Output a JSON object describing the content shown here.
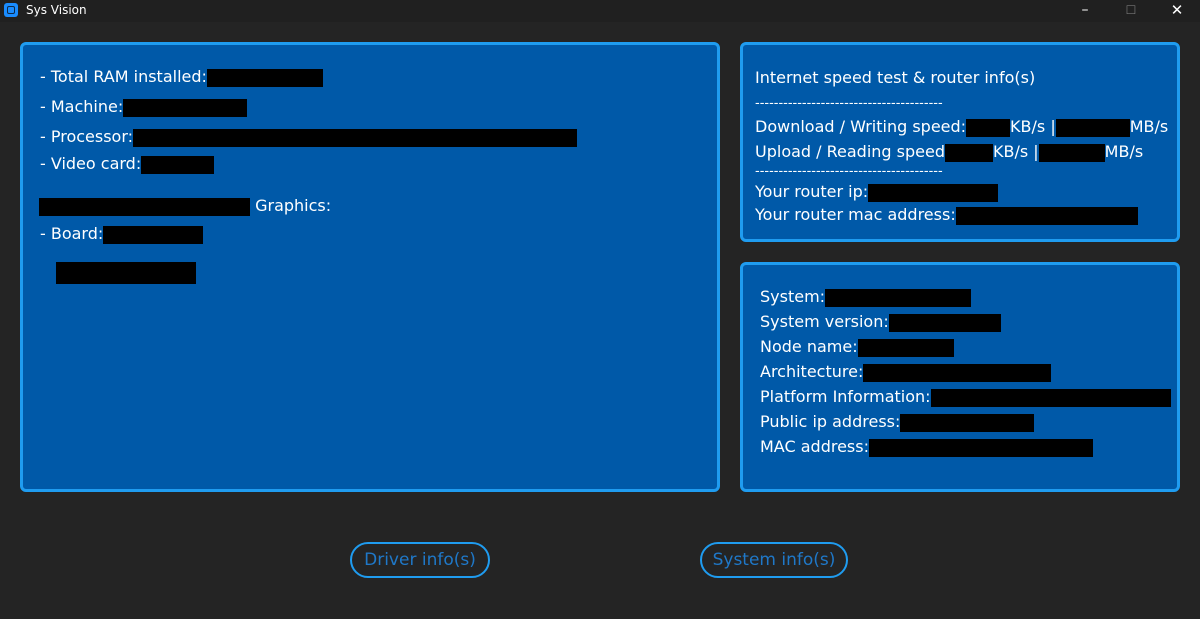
{
  "window": {
    "title": "Sys Vision",
    "minimize_glyph": "–",
    "maximize_glyph": "☐",
    "close_glyph": "✕"
  },
  "hardware": {
    "ram_label": "- Total RAM installed:",
    "machine_label": "- Machine:",
    "processor_label": "- Processor:",
    "video_label": "- Video card:",
    "graphics_label": "Graphics:",
    "board_label": "- Board:"
  },
  "network": {
    "title": "Internet speed test & router info(s)",
    "divider": "----------------------------------------",
    "download_label": "Download / Writing speed:",
    "upload_label": "Upload / Reading speed",
    "kbs_unit": "KB/s |",
    "mbs_unit": "MB/s",
    "router_ip_label": "Your router ip:",
    "router_mac_label": "Your router mac address:"
  },
  "system": {
    "system_label": "System:",
    "version_label": "System version:",
    "node_label": "Node name:",
    "arch_label": "Architecture:",
    "platform_label": "Platform Information:",
    "public_ip_label": "Public ip address:",
    "mac_label": "MAC address:"
  },
  "buttons": {
    "driver": "Driver info(s)",
    "system": "System info(s)"
  },
  "colors": {
    "panel_bg": "#0059a8",
    "panel_border": "#1f9cf0",
    "window_bg": "#242424",
    "redaction": "#000000"
  }
}
